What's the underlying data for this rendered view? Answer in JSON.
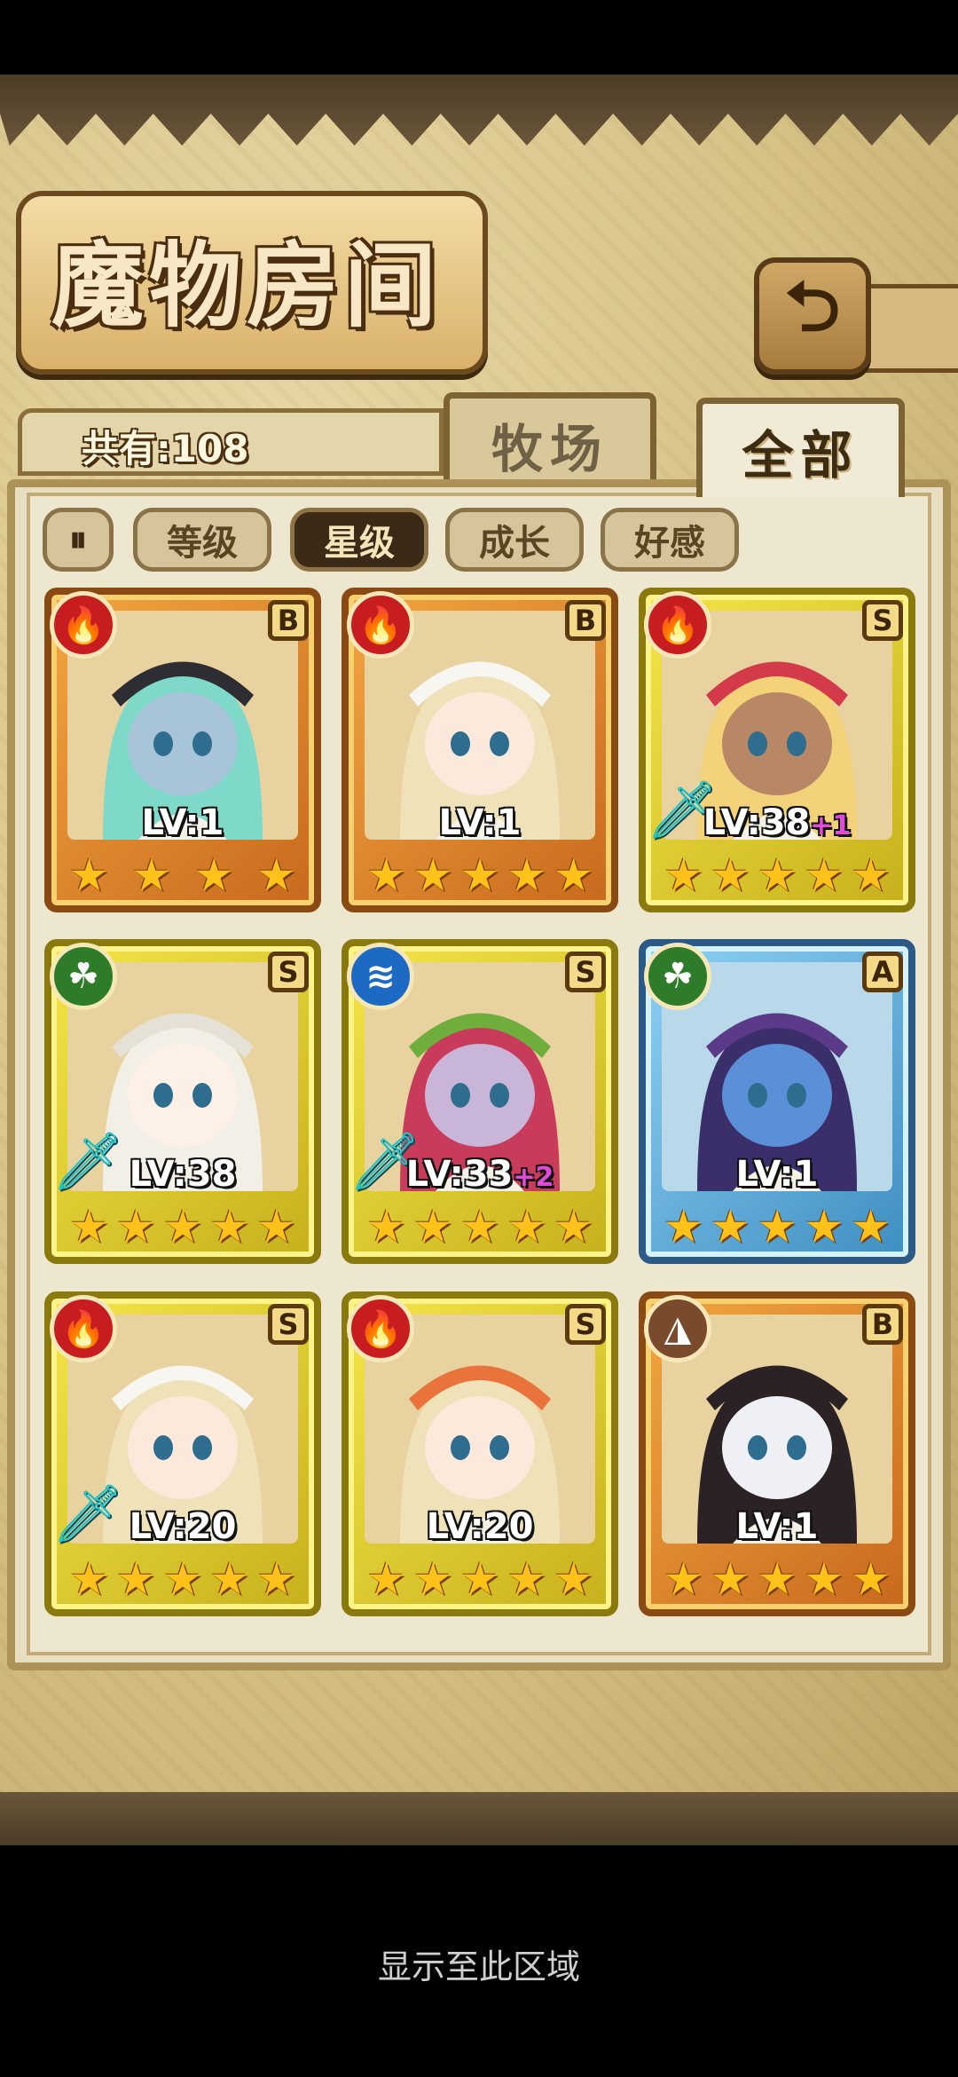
{
  "header": {
    "title": "魔物房间",
    "back_icon": "back-arrow-icon"
  },
  "summary": {
    "count_label": "共有:108"
  },
  "tabs": [
    {
      "label": "牧场",
      "active": false
    },
    {
      "label": "全部",
      "active": true
    }
  ],
  "sort": {
    "toggle_icon": "sort-toggle-icon",
    "toggle_glyph": "⏸",
    "filters": [
      {
        "label": "等级",
        "active": false
      },
      {
        "label": "星级",
        "active": true
      },
      {
        "label": "成长",
        "active": false
      },
      {
        "label": "好感",
        "active": false
      }
    ]
  },
  "monsters": [
    {
      "element": "fire",
      "element_glyph": "🔥",
      "rank": "B",
      "level": "LV:1",
      "bonus": "",
      "stars": 4,
      "weapon": false,
      "hair": "#7fd9c8",
      "hat": "#2d2d33",
      "skin": "#a8c4d8"
    },
    {
      "element": "fire",
      "element_glyph": "🔥",
      "rank": "B",
      "level": "LV:1",
      "bonus": "",
      "stars": 5,
      "weapon": false,
      "hair": "#efe2b9",
      "hat": "#f8f6f0",
      "skin": "#fbe9dc"
    },
    {
      "element": "fire",
      "element_glyph": "🔥",
      "rank": "S",
      "level": "LV:38",
      "bonus": "+1",
      "stars": 5,
      "weapon": true,
      "hair": "#f3d27a",
      "hat": "#d43b4a",
      "skin": "#b88766"
    },
    {
      "element": "nature",
      "element_glyph": "☘",
      "rank": "S",
      "level": "LV:38",
      "bonus": "",
      "stars": 5,
      "weapon": true,
      "hair": "#f2efe6",
      "hat": "#e5e1d6",
      "skin": "#fdf0e6"
    },
    {
      "element": "water",
      "element_glyph": "≋",
      "rank": "S",
      "level": "LV:33",
      "bonus": "+2",
      "stars": 5,
      "weapon": true,
      "hair": "#c93b5a",
      "hat": "#6fae3d",
      "skin": "#c9b5d8"
    },
    {
      "element": "nature",
      "element_glyph": "☘",
      "rank": "A",
      "level": "LV:1",
      "bonus": "",
      "stars": 5,
      "weapon": false,
      "hair": "#3a2f6b",
      "hat": "#5b3a8a",
      "skin": "#5b90d8"
    },
    {
      "element": "fire",
      "element_glyph": "🔥",
      "rank": "S",
      "level": "LV:20",
      "bonus": "",
      "stars": 5,
      "weapon": true,
      "hair": "#efe2b9",
      "hat": "#f8f6f0",
      "skin": "#fbe9dc"
    },
    {
      "element": "fire",
      "element_glyph": "🔥",
      "rank": "S",
      "level": "LV:20",
      "bonus": "",
      "stars": 5,
      "weapon": false,
      "hair": "#efe2b9",
      "hat": "#e9733a",
      "skin": "#fbe9dc"
    },
    {
      "element": "earth",
      "element_glyph": "◮",
      "rank": "B",
      "level": "LV:1",
      "bonus": "",
      "stars": 5,
      "weapon": false,
      "hair": "#2b2226",
      "hat": "#2b2226",
      "skin": "#eef0f6"
    }
  ],
  "android_hint": "显示至此区域"
}
